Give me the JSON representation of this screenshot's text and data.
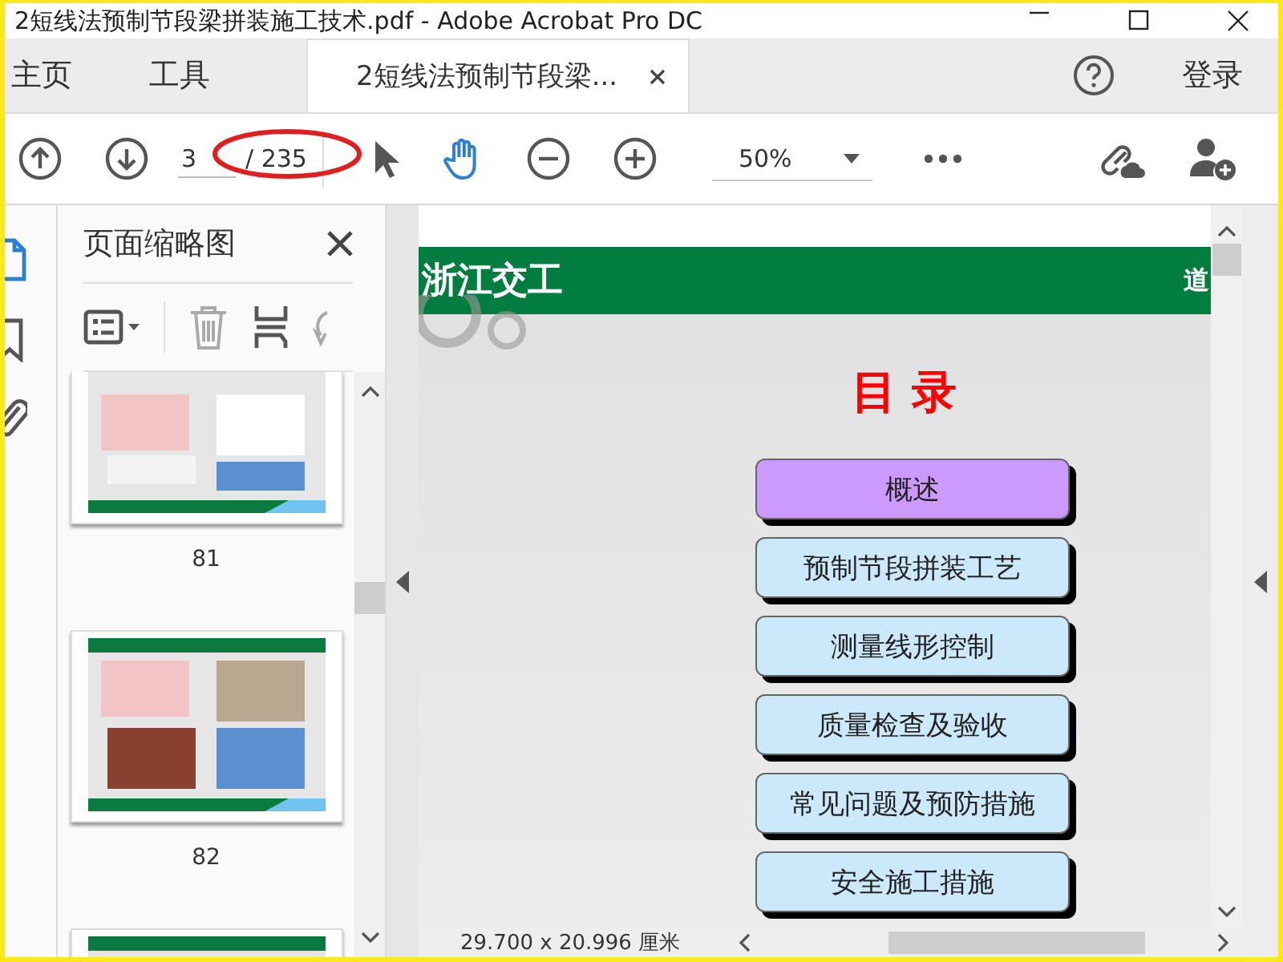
{
  "window": {
    "title": "2短线法预制节段梁拼装施工技术.pdf - Adobe Acrobat Pro DC"
  },
  "tabs": [
    {
      "label": "主页",
      "selected": false,
      "closable": false
    },
    {
      "label": "工具",
      "selected": false,
      "closable": false
    },
    {
      "label": "2短线法预制节段梁...",
      "selected": true,
      "closable": true
    }
  ],
  "account": {
    "login": "登录"
  },
  "toolbar": {
    "page_value": "3",
    "page_total": "/ 235",
    "zoom": "50%",
    "tools": [
      {
        "kind": "select",
        "selected": false
      },
      {
        "kind": "hand",
        "selected": true
      }
    ]
  },
  "sidebar": {
    "rail": [
      {
        "kind": "pages",
        "selected": true
      },
      {
        "kind": "bookmarks",
        "selected": false
      },
      {
        "kind": "attachments",
        "selected": false
      }
    ],
    "title": "页面缩略图",
    "thumbnails": [
      {
        "kind": "picture",
        "page": "81"
      },
      {
        "kind": "picture",
        "page": "82"
      },
      {
        "kind": "picture"
      }
    ]
  },
  "document": {
    "brand": "浙江交工",
    "header_right": "道",
    "title": "目 录",
    "items": [
      {
        "label": "概述",
        "color": "#cc99ff"
      },
      {
        "label": "预制节段拼装工艺",
        "color": "#cce9fb"
      },
      {
        "label": "测量线形控制",
        "color": "#cce9fb"
      },
      {
        "label": "质量检查及验收",
        "color": "#cce9fb"
      },
      {
        "label": "常见问题及预防措施",
        "color": "#cce9fb"
      },
      {
        "label": "安全施工措施",
        "color": "#cce9fb"
      }
    ]
  },
  "status_bar": {
    "page_size": "29.700 x 20.996 厘米"
  }
}
